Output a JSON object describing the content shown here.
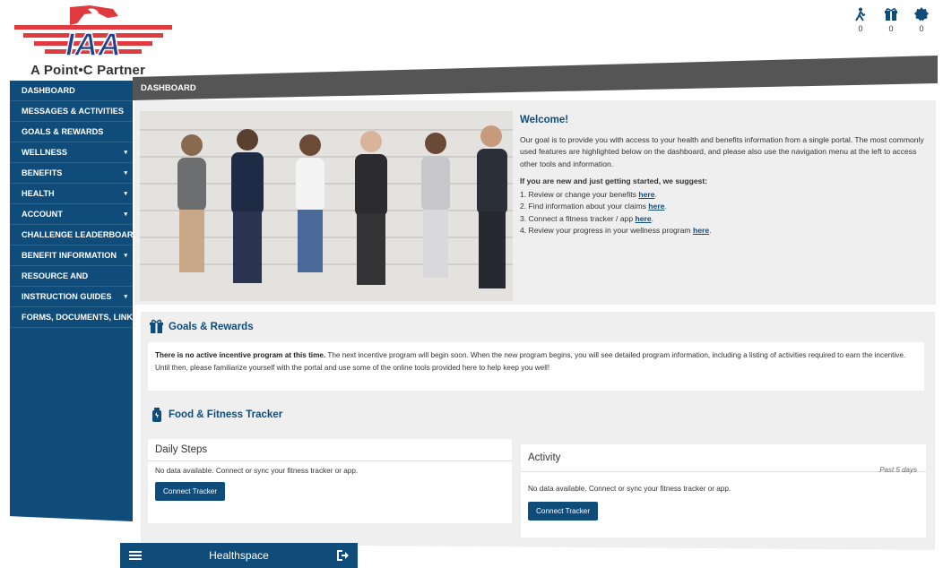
{
  "brand": {
    "logo_text": "IAA",
    "tagline": "A Point•C Partner",
    "colors": {
      "primary": "#0f4c7a",
      "brand_red": "#e03a3e",
      "brand_blue": "#1f3f8f"
    }
  },
  "top_icons": [
    {
      "icon": "walker-icon",
      "count": "0"
    },
    {
      "icon": "gift-icon",
      "count": "0"
    },
    {
      "icon": "badge-icon",
      "count": "0"
    }
  ],
  "header": {
    "title": "DASHBOARD"
  },
  "sidebar": {
    "items": [
      {
        "label": "DASHBOARD",
        "caret": ""
      },
      {
        "label": "MESSAGES & ACTIVITIES",
        "caret": ""
      },
      {
        "label": "GOALS & REWARDS",
        "caret": ""
      },
      {
        "label": "WELLNESS",
        "caret": "▾"
      },
      {
        "label": "BENEFITS",
        "caret": "▾"
      },
      {
        "label": "HEALTH",
        "caret": "▾"
      },
      {
        "label": "ACCOUNT",
        "caret": "▾"
      },
      {
        "label": "CHALLENGE LEADERBOARD",
        "caret": ""
      },
      {
        "label": "BENEFIT INFORMATION",
        "caret": "▾"
      },
      {
        "label": "RESOURCE AND",
        "caret": ""
      },
      {
        "label": "INSTRUCTION GUIDES",
        "caret": "▾"
      },
      {
        "label": "FORMS, DOCUMENTS, LINKS",
        "caret": ""
      }
    ]
  },
  "welcome": {
    "title": "Welcome!",
    "intro": "Our goal is to provide you with access to your health and benefits information from a single portal. The most commonly used features are highlighted below on the dashboard, and please also use the navigation menu at the left to access other tools and information.",
    "lead": "If you are new and just getting started, we suggest:",
    "steps": [
      {
        "text": "1. Review or change your benefits ",
        "link": "here"
      },
      {
        "text": "2. Find information about your claims ",
        "link": "here"
      },
      {
        "text": "3. Connect a fitness tracker / app ",
        "link": "here"
      },
      {
        "text": "4. Review your progress in your wellness program ",
        "link": "here"
      }
    ]
  },
  "goals": {
    "title": "Goals & Rewards",
    "bold": "There is no active incentive program at this time.",
    "body": " The next incentive program will begin soon. When the new program begins, you will see detailed program information, including a listing of activities required to earn the incentive. Until then, please familiarize yourself with the portal and use some of the online tools provided here to help keep you well!"
  },
  "tracker": {
    "title": "Food & Fitness Tracker",
    "steps_card": {
      "title": "Daily Steps",
      "message": "No data available. Connect or sync your fitness tracker or app.",
      "button": "Connect Tracker"
    },
    "activity_card": {
      "title": "Activity",
      "subtitle": "Past 5 days",
      "message": "No data available. Connect or sync your fitness tracker or app.",
      "button": "Connect Tracker"
    }
  },
  "bottombar": {
    "title": "Healthspace"
  }
}
